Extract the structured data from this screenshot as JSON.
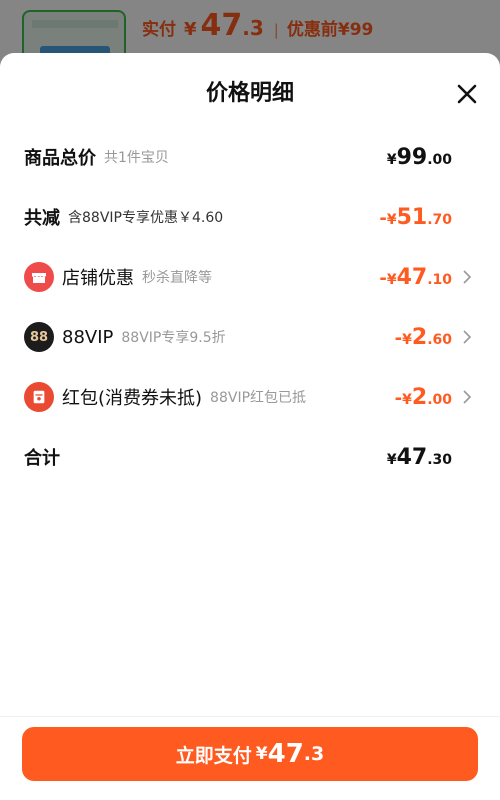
{
  "background": {
    "paid_label": "实付",
    "yen": "¥",
    "paid_int": "47",
    "paid_dec": ".3",
    "separator": "|",
    "before_label": "优惠前¥99"
  },
  "sheet": {
    "title": "价格明细",
    "close_icon": "close-icon"
  },
  "rows": {
    "total": {
      "label": "商品总价",
      "sub": "共1件宝贝",
      "yen": "¥",
      "int": "99",
      "dec": ".00"
    },
    "discount": {
      "label": "共减",
      "sub": "含88VIP专享优惠￥4.60",
      "minus": "-",
      "yen": "¥",
      "int": "51",
      "dec": ".70"
    },
    "shop": {
      "icon": "shop-icon",
      "label": "店铺优惠",
      "sub": "秒杀直降等",
      "minus": "-",
      "yen": "¥",
      "int": "47",
      "dec": ".10"
    },
    "vip": {
      "icon_text": "88",
      "label": "88VIP",
      "sub": "88VIP专享9.5折",
      "minus": "-",
      "yen": "¥",
      "int": "2",
      "dec": ".60"
    },
    "redpacket": {
      "icon": "red-packet-icon",
      "label": "红包(消费券未抵)",
      "sub": "88VIP红包已抵",
      "minus": "-",
      "yen": "¥",
      "int": "2",
      "dec": ".00"
    },
    "sum": {
      "label": "合计",
      "yen": "¥",
      "int": "47",
      "dec": ".30"
    }
  },
  "pay_button": {
    "label": "立即支付",
    "yen": "¥",
    "int": "47",
    "dec": ".3"
  },
  "colors": {
    "accent": "#ff5a1f",
    "shop_icon": "#ef4b4b",
    "vip_icon_bg": "#1c1c1c",
    "vip_icon_text": "#e6c79b",
    "red_packet_icon": "#ea4a32"
  }
}
